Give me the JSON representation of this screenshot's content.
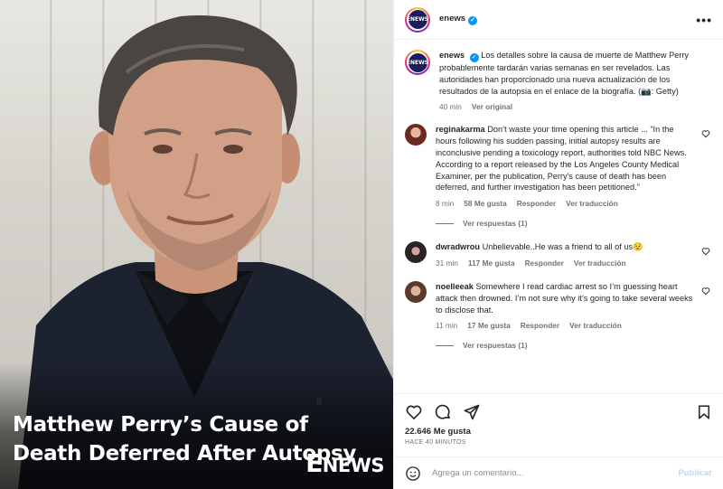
{
  "post_image": {
    "headline": "Matthew Perry’s Cause of Death Deferred After Autopsy",
    "brand_e": "E",
    "brand_news": "NEWS"
  },
  "header": {
    "username": "enews",
    "avatar_text": "ENEWS",
    "verified_icon": "verified-badge-icon",
    "more_icon": "more-options-icon"
  },
  "caption": {
    "username": "enews",
    "text": "Los detalles sobre la causa de muerte de Matthew Perry probablemente tardarán varias semanas en ser revelados. Las autoridades han proporcionado una nueva actualización de los resultados de la autopsia en el enlace de la biografía. (📷: Getty)",
    "time": "40 min",
    "translate": "Ver original"
  },
  "comments": [
    {
      "username": "reginakarma",
      "text": "Don’t waste your time opening this article ... “In the hours following his sudden passing, initial autopsy results are inconclusive pending a toxicology report, authorities told NBC News. According to a report released by the Los Angeles County Medical Examiner, per the publication, Perry's cause of death has been deferred, and further investigation has been petitioned.”",
      "time": "8 min",
      "likes": "58 Me gusta",
      "reply": "Responder",
      "translate": "Ver traducción",
      "replies": "Ver respuestas (1)"
    },
    {
      "username": "dwradwrou",
      "text": "Unbelievable..He was a friend to all of us😟",
      "time": "31 min",
      "likes": "117 Me gusta",
      "reply": "Responder",
      "translate": "Ver traducción"
    },
    {
      "username": "noelleeak",
      "text": "Somewhere I read cardiac arrest so I’m guessing heart attack then drowned. I’m not sure why it’s going to take several weeks to disclose that.",
      "time": "11 min",
      "likes": "17 Me gusta",
      "reply": "Responder",
      "translate": "Ver traducción",
      "replies": "Ver respuestas (1)"
    }
  ],
  "actions": {
    "like_icon": "heart-icon",
    "comment_icon": "comment-icon",
    "share_icon": "share-icon",
    "save_icon": "bookmark-icon"
  },
  "stats": {
    "likes": "22.646 Me gusta",
    "ago": "HACE 40 MINUTOS"
  },
  "composer": {
    "emoji_icon": "emoji-icon",
    "placeholder": "Agrega un comentario...",
    "publish": "Publicar"
  },
  "colors": {
    "accent": "#0095f6",
    "publish_disabled": "#b3dbff",
    "secondary_text": "#737373"
  }
}
